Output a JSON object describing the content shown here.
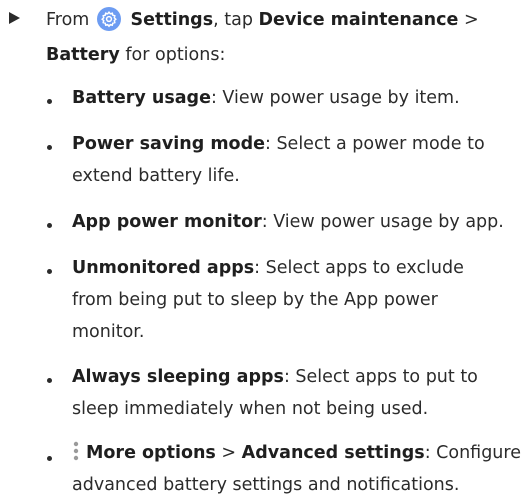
{
  "intro": {
    "from": "From",
    "settings": "Settings",
    "tap": ", tap",
    "device_maintenance": "Device maintenance",
    "sep": ">",
    "battery": "Battery",
    "for_options": "for options:"
  },
  "items": [
    {
      "bold": "Battery usage",
      "lines": [
        ": View power usage by item."
      ]
    },
    {
      "bold": "Power saving mode",
      "lines": [
        ": Select a power mode to",
        "extend battery life."
      ]
    },
    {
      "bold": "App power monitor",
      "lines": [
        ": View power usage by app."
      ]
    },
    {
      "bold": "Unmonitored apps",
      "lines": [
        ": Select apps to exclude",
        "from being put to sleep by the App power",
        "monitor."
      ]
    },
    {
      "bold": "Always sleeping apps",
      "lines": [
        ": Select apps to put to",
        "sleep immediately when not being used."
      ]
    },
    {
      "bold": "More options",
      "sep": ">",
      "bold2": "Advanced settings",
      "lines": [
        ": Configure",
        "advanced battery settings and notifications."
      ]
    }
  ],
  "icons": {
    "settings": "settings-gear-icon",
    "more_options": "more-options-vertical-dots-icon",
    "arrow": "triangle-bullet-icon"
  },
  "colors": {
    "text": "#2b2b2b",
    "settings_icon_bg": "#6d9cf2"
  }
}
